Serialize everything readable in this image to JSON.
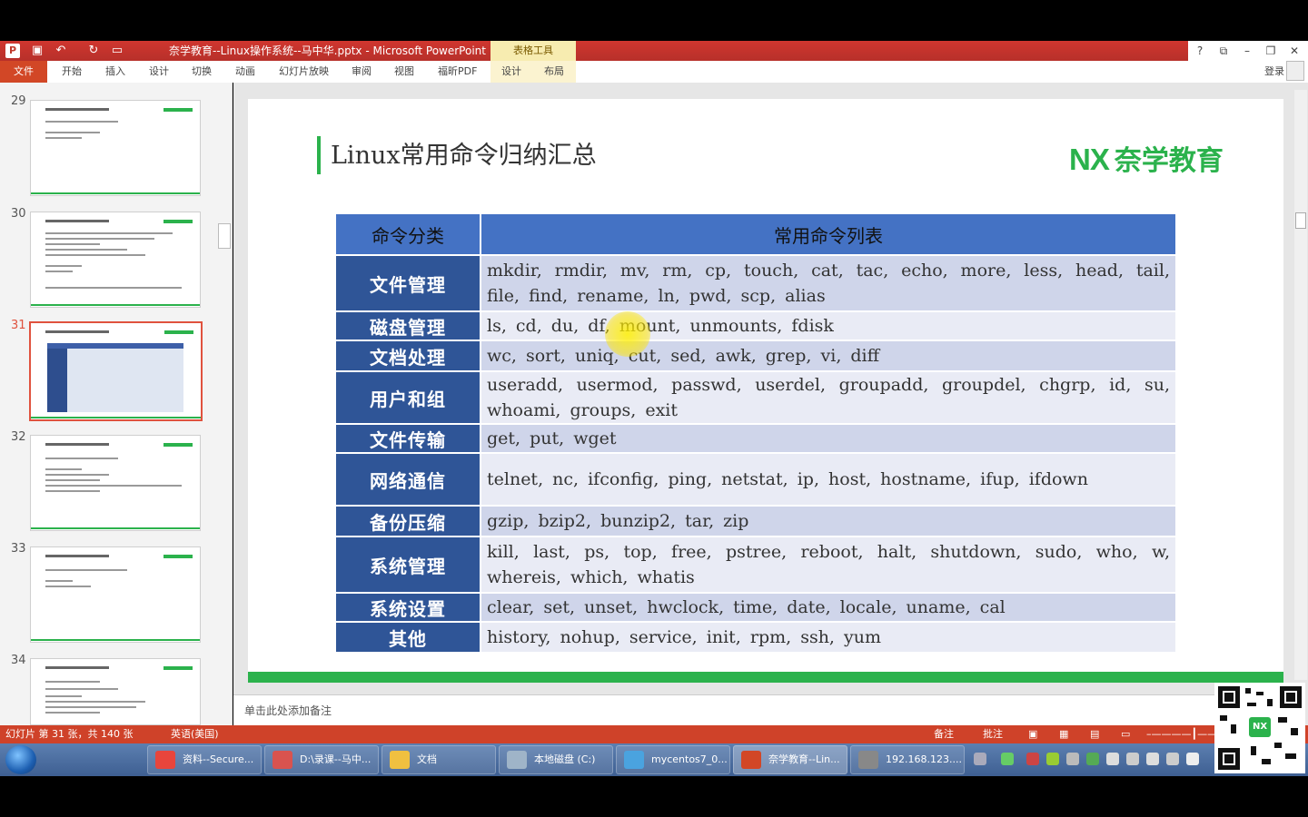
{
  "window": {
    "title": "奈学教育--Linux操作系统--马中华.pptx - Microsoft PowerPoint",
    "context_tab_group": "表格工具",
    "help": "?",
    "restore_ribbon": "⧉",
    "minimize": "–",
    "maximize": "❐",
    "close": "✕"
  },
  "quick_access": {
    "app_icon": "P",
    "save_icon": "save-icon",
    "undo_icon": "undo-icon",
    "redo_icon": "redo-icon",
    "present_icon": "present-icon"
  },
  "ribbon": {
    "file_tab": "文件",
    "tabs": [
      "开始",
      "插入",
      "设计",
      "切换",
      "动画",
      "幻灯片放映",
      "审阅",
      "视图",
      "福昕PDF"
    ],
    "context_tabs": [
      "设计",
      "布局"
    ],
    "login": "登录"
  },
  "thumbnails": {
    "numbers": [
      "29",
      "30",
      "31",
      "32",
      "33",
      "34"
    ],
    "selected": "31"
  },
  "slide": {
    "title": "Linux常用命令归纳汇总",
    "logo_mark": "NX",
    "logo_text": "奈学教育",
    "table": {
      "headers": [
        "命令分类",
        "常用命令列表"
      ],
      "rows": [
        {
          "category": "文件管理",
          "commands": "mkdir, rmdir, mv, rm, cp, touch, cat, tac, echo, more, less, head, tail, file, find, rename, ln, pwd, scp, alias"
        },
        {
          "category": "磁盘管理",
          "commands": "ls, cd, du, df, mount, unmounts, fdisk"
        },
        {
          "category": "文档处理",
          "commands": "wc, sort, uniq, cut, sed, awk, grep, vi, diff"
        },
        {
          "category": "用户和组",
          "commands": "useradd, usermod, passwd, userdel, groupadd, groupdel, chgrp, id, su, whoami, groups, exit"
        },
        {
          "category": "文件传输",
          "commands": "get, put, wget"
        },
        {
          "category": "网络通信",
          "commands": "telnet, nc, ifconfig, ping, netstat, ip, host, hostname, ifup, ifdown"
        },
        {
          "category": "备份压缩",
          "commands": "gzip, bzip2, bunzip2, tar, zip"
        },
        {
          "category": "系统管理",
          "commands": "kill, last, ps, top, free, pstree, reboot, halt, shutdown, sudo, who, w, whereis, which, whatis"
        },
        {
          "category": "系统设置",
          "commands": "clear, set, unset, hwclock, time, date, locale, uname, cal"
        },
        {
          "category": "其他",
          "commands": "history, nohup, service, init, rpm, ssh, yum"
        }
      ]
    }
  },
  "notes": {
    "placeholder": "单击此处添加备注"
  },
  "statusbar": {
    "slide_info": "幻灯片 第 31 张，共 140 张",
    "language": "英语(美国)",
    "notes": "备注",
    "comments": "批注"
  },
  "taskbar": {
    "items": [
      {
        "label": "资料--Secure...",
        "icon": "chrome-icon",
        "color": "#e8453c"
      },
      {
        "label": "D:\\录课--马中...",
        "icon": "folder-app-icon",
        "color": "#d9534f"
      },
      {
        "label": "文档",
        "icon": "folder-icon",
        "color": "#f0c040"
      },
      {
        "label": "本地磁盘 (C:)",
        "icon": "drive-icon",
        "color": "#9fb4c8"
      },
      {
        "label": "mycentos7_0...",
        "icon": "vm-icon",
        "color": "#4aa3df"
      },
      {
        "label": "奈学教育--Lin...",
        "icon": "powerpoint-icon",
        "color": "#d24726"
      },
      {
        "label": "192.168.123....",
        "icon": "terminal-icon",
        "color": "#888888"
      }
    ]
  },
  "colors": {
    "brand_green": "#2bb24c",
    "table_header": "#4472c4",
    "table_category": "#2f5597",
    "ppt_red": "#d24726"
  }
}
